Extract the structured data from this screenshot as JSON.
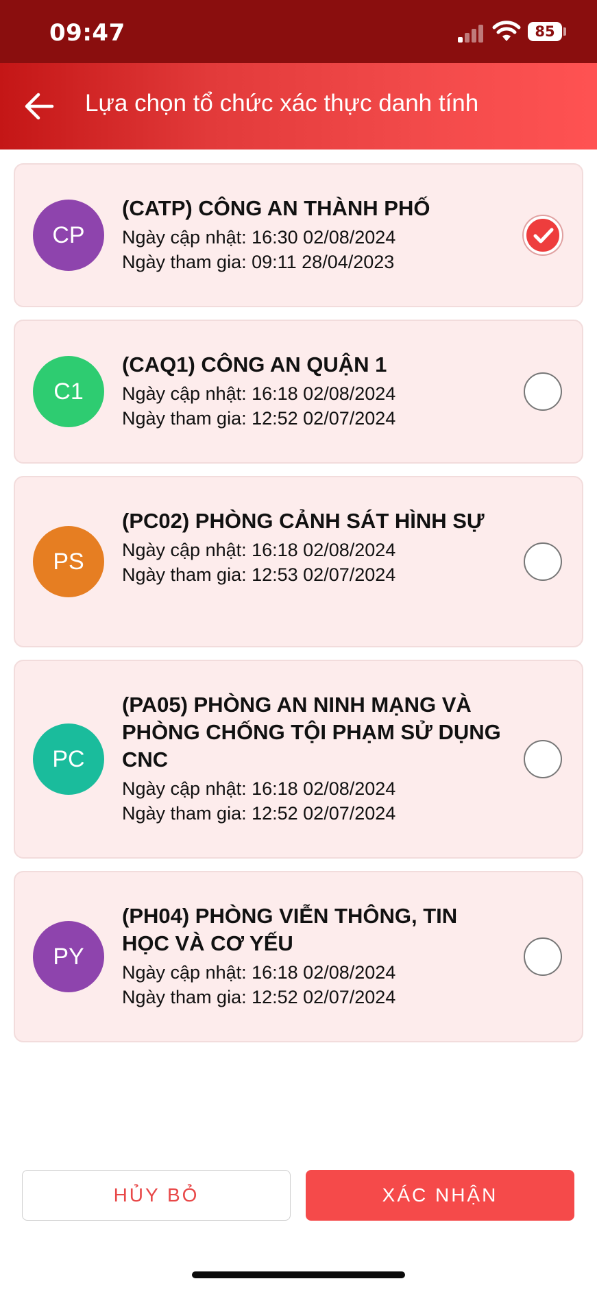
{
  "status_bar": {
    "time": "09:47",
    "battery": "85",
    "icons": [
      "signal-icon",
      "wifi-icon",
      "battery-icon"
    ]
  },
  "header": {
    "title": "Lựa chọn tổ chức xác thực danh tính",
    "back_icon": "arrow-left-icon",
    "background_colors": [
      "#c41616",
      "#ff5252"
    ]
  },
  "organizations": [
    {
      "initials": "CP",
      "avatar_color": "#8e44ad",
      "name": "(CATP) CÔNG AN THÀNH PHỐ",
      "updated": "Ngày cập nhật: 16:30 02/08/2024",
      "joined": "Ngày tham gia: 09:11 28/04/2023",
      "selected": true
    },
    {
      "initials": "C1",
      "avatar_color": "#2ecc71",
      "name": "(CAQ1) CÔNG AN QUẬN 1",
      "updated": "Ngày cập nhật: 16:18 02/08/2024",
      "joined": "Ngày tham gia: 12:52 02/07/2024",
      "selected": false
    },
    {
      "initials": "PS",
      "avatar_color": "#e67e22",
      "name": "(PC02) PHÒNG CẢNH SÁT HÌNH SỰ",
      "updated": "Ngày cập nhật: 16:18 02/08/2024",
      "joined": "Ngày tham gia: 12:53 02/07/2024",
      "selected": false
    },
    {
      "initials": "PC",
      "avatar_color": "#1abc9c",
      "name": "(PA05) PHÒNG AN NINH MẠNG VÀ PHÒNG CHỐNG TỘI PHẠM SỬ DỤNG CNC",
      "updated": "Ngày cập nhật: 16:18 02/08/2024",
      "joined": "Ngày tham gia: 12:52 02/07/2024",
      "selected": false
    },
    {
      "initials": "PY",
      "avatar_color": "#8e44ad",
      "name": "(PH04) PHÒNG VIỄN THÔNG, TIN HỌC VÀ CƠ YẾU",
      "updated": "Ngày cập nhật: 16:18 02/08/2024",
      "joined": "Ngày tham gia: 12:52 02/07/2024",
      "selected": false
    }
  ],
  "footer": {
    "cancel_label": "HỦY BỎ",
    "confirm_label": "XÁC NHẬN",
    "accent_color": "#f54a4a"
  }
}
